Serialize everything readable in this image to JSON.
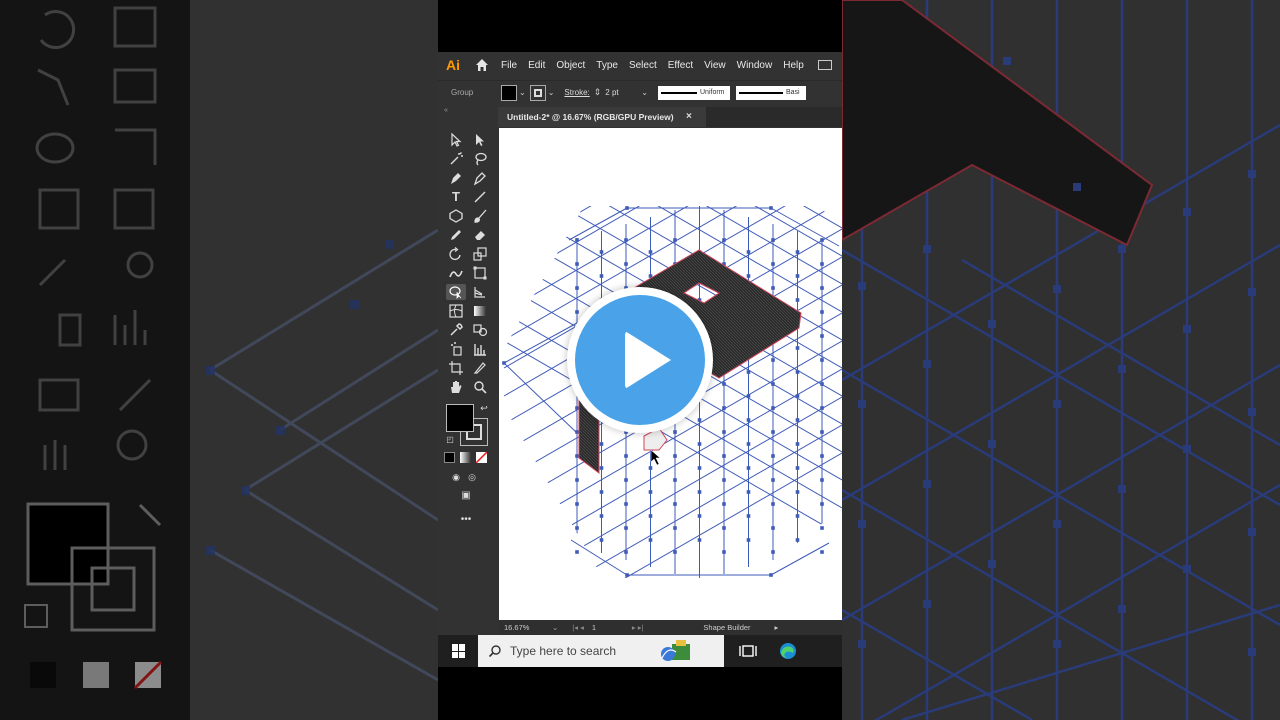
{
  "app": {
    "logo": "Ai",
    "menu": [
      "File",
      "Edit",
      "Object",
      "Type",
      "Select",
      "Effect",
      "View",
      "Window",
      "Help"
    ]
  },
  "control_bar": {
    "selection": "Group",
    "stroke_label": "Stroke:",
    "stroke_weight": "2 pt",
    "profile": "Uniform",
    "brush": "Basi"
  },
  "document": {
    "tab_title": "Untitled-2* @ 16.67% (RGB/GPU Preview)",
    "close": "×"
  },
  "status": {
    "zoom": "16.67%",
    "page": "1",
    "current_tool": "Shape Builder"
  },
  "taskbar": {
    "search_placeholder": "Type here to search"
  },
  "colors": {
    "grid_line": "#3f5bb8",
    "shape_outline": "#d2455a",
    "play_button": "#4aa3e8",
    "ui_dark": "#323232"
  }
}
